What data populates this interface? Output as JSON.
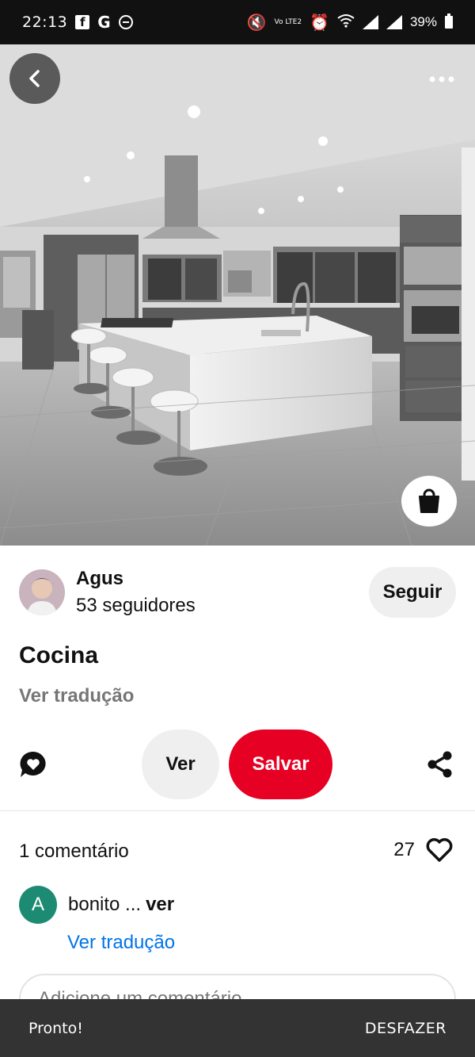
{
  "status_bar": {
    "time": "22:13",
    "battery": "39%",
    "network_label": "Vo LTE2",
    "icons": [
      "facebook-icon",
      "google-icon",
      "do-not-disturb-icon",
      "mute-icon",
      "alarm-icon",
      "wifi-icon",
      "signal-icon",
      "battery-icon"
    ]
  },
  "hero": {
    "icons": {
      "back": "chevron-left-icon",
      "more": "more-horizontal-icon",
      "shop": "shopping-bag-icon"
    }
  },
  "author": {
    "name": "Agus",
    "followers": "53 seguidores",
    "follow_label": "Seguir"
  },
  "pin": {
    "title": "Cocina",
    "translate_label": "Ver tradução"
  },
  "actions": {
    "view_label": "Ver",
    "save_label": "Salvar",
    "icons": {
      "comment": "comment-bubble-icon",
      "share": "share-icon"
    },
    "save_color": "#e60023"
  },
  "comments": {
    "count_label": "1 comentário",
    "likes": "27",
    "items": [
      {
        "avatar_letter": "A",
        "text": "bonito ...",
        "more_label": "ver",
        "translate_label": "Ver tradução"
      }
    ],
    "input_placeholder": "Adicione um comentário"
  },
  "snackbar": {
    "message": "Pronto!",
    "action_label": "DESFAZER"
  }
}
